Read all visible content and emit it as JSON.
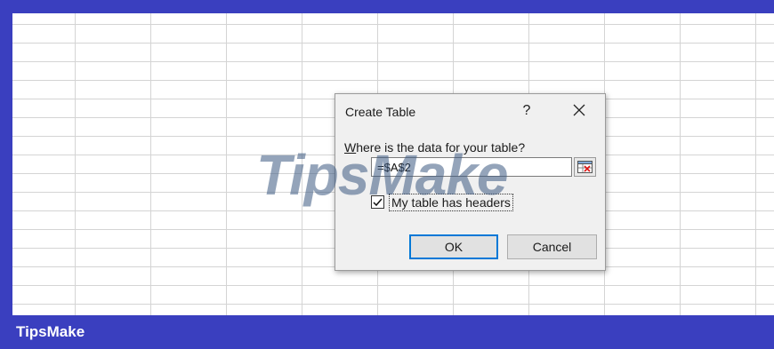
{
  "colors": {
    "frame": "#3a3fbf",
    "gridline": "#d4d4d4",
    "dialog_bg": "#f0f0f0",
    "ok_focus": "#0078d7",
    "watermark": "#3c5a82"
  },
  "footer": {
    "brand": "TipsMake"
  },
  "watermark": {
    "text": "TipsMake"
  },
  "dialog": {
    "title": "Create Table",
    "help_label": "?",
    "close_icon": "close-icon",
    "prompt_accel": "W",
    "prompt_rest": "here is the data for your table?",
    "range_value": "=$A$2",
    "collapse_icon": "range-collapse-icon",
    "headers_checked": true,
    "headers_label": "My table has headers",
    "ok_label": "OK",
    "cancel_label": "Cancel"
  }
}
